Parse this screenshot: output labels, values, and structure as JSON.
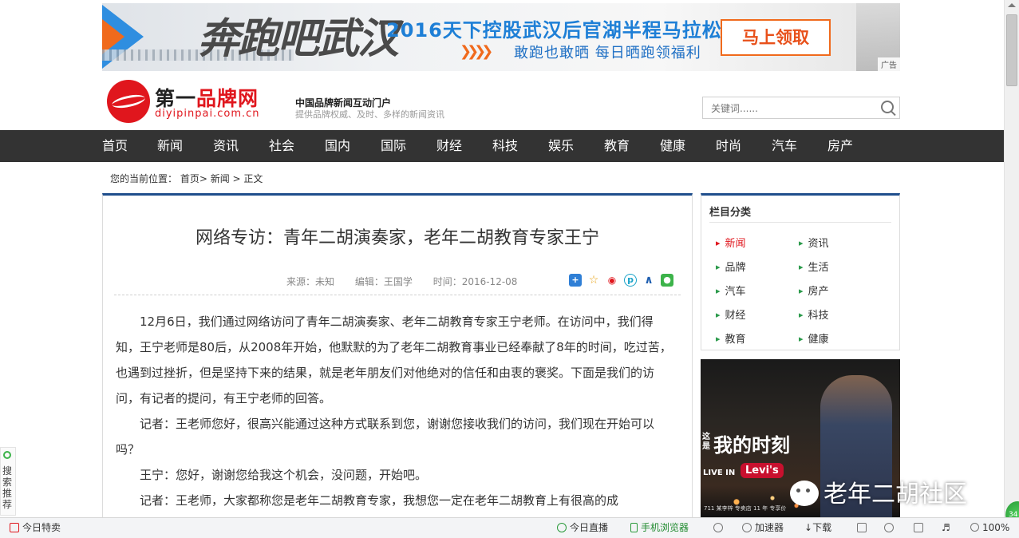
{
  "banner": {
    "slogan": "奔跑吧武汉",
    "event": "2016天下控股武汉后官湖半程马拉松",
    "tagline": "敢跑也敢晒 每日晒跑领福利",
    "cta": "马上领取",
    "ad_tag": "广告",
    "accent": "#f06a1c",
    "blue": "#1e7fd6"
  },
  "header": {
    "logo_part1": "第一",
    "logo_part2": "品牌网",
    "domain": "diyipinpai.com.cn",
    "tagline": "中国品牌新闻互动门户",
    "desc": "提供品牌权威、及时、多样的新闻资讯",
    "search_placeholder": "关键词......",
    "brand_red": "#e0161d"
  },
  "nav": {
    "items": [
      "首页",
      "新闻",
      "资讯",
      "社会",
      "国内",
      "国际",
      "财经",
      "科技",
      "娱乐",
      "教育",
      "健康",
      "时尚",
      "汽车",
      "房产"
    ],
    "bg": "#333333"
  },
  "breadcrumb": {
    "label": "您的当前位置：",
    "path": "首页> 新闻 > 正文"
  },
  "article": {
    "title": "网络专访：青年二胡演奏家，老年二胡教育专家王宁",
    "source": "来源：未知",
    "editor": "编辑：王国学",
    "time": "时间：2016-12-08",
    "share_icons": [
      "plus-icon",
      "star-icon",
      "weibo-icon",
      "p-icon",
      "a-icon",
      "wechat-icon"
    ],
    "paragraphs": [
      "12月6日，我们通过网络访问了青年二胡演奏家、老年二胡教育专家王宁老师。在访问中，我们得知，王宁老师是80后，从2008年开始，他默默的为了老年二胡教育事业已经奉献了8年的时间，吃过苦，也遇到过挫折，但是坚持下来的结果，就是老年朋友们对他绝对的信任和由衷的褒奖。下面是我们的访问，有记者的提问，有王宁老师的回答。",
      "记者：王老师您好，很高兴能通过这种方式联系到您，谢谢您接收我们的访问，我们现在开始可以吗？",
      "王宁：您好，谢谢您给我这个机会，没问题，开始吧。",
      "记者：王老师，大家都称您是老年二胡教育专家，我想您一定在老年二胡教育上有很高的成"
    ]
  },
  "sidebar": {
    "title": "栏目分类",
    "categories": [
      "新闻",
      "资讯",
      "品牌",
      "生活",
      "汽车",
      "房产",
      "财经",
      "科技",
      "教育",
      "健康"
    ],
    "active": "新闻"
  },
  "side_ad": {
    "side_text": "这是",
    "headline": "我的时刻",
    "live_in": "LIVE IN",
    "brand": "Levi's",
    "store": "711 某李梓 专卖店 11 年 专享价"
  },
  "watermark": "老年二胡社区",
  "left_widget": "搜索推荐",
  "corner_badge": "34",
  "statusbar": {
    "left": "今日特卖",
    "live": "今日直播",
    "mobile": "手机浏览器",
    "accel": "加速器",
    "download": "下载",
    "zoom": "100%"
  }
}
